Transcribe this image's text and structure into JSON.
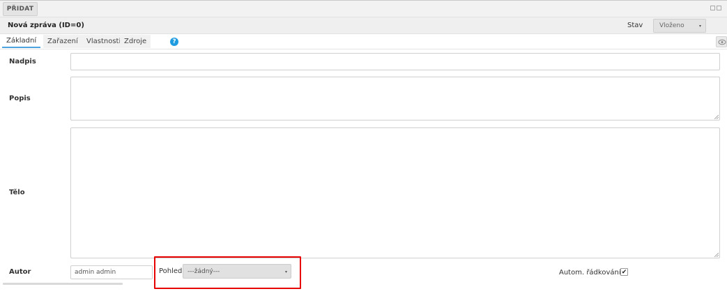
{
  "toolbar": {
    "add_label": "PŘIDAT"
  },
  "header": {
    "title": "Nová zpráva (ID=0)",
    "stav_label": "Stav",
    "stav_value": "Vloženo"
  },
  "tabs": [
    {
      "label": "Základní",
      "active": true
    },
    {
      "label": "Zařazení",
      "active": false
    },
    {
      "label": "Vlastnosti",
      "active": false
    },
    {
      "label": "Zdroje",
      "active": false
    }
  ],
  "help": {
    "glyph": "?"
  },
  "form": {
    "nadpis_label": "Nadpis",
    "nadpis_value": "",
    "popis_label": "Popis",
    "popis_value": "",
    "telo_label": "Tělo",
    "telo_value": "",
    "autor_label": "Autor",
    "autor_value": "admin admin",
    "pohled_label": "Pohled",
    "pohled_value": "---žádný---",
    "autowrap_label": "Autom. řádkování",
    "autowrap_checked": true,
    "check_glyph": "✔"
  },
  "icons": {
    "select_arrow": "▾",
    "eye": "eye-icon",
    "window_controls": "window-controls-icon",
    "help": "help-icon"
  },
  "colors": {
    "highlight": "#e60000",
    "tab_active": "#4aa3df",
    "help_icon": "#1f9ce0"
  }
}
